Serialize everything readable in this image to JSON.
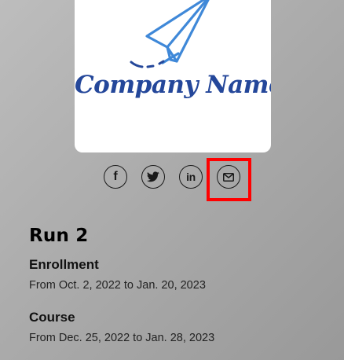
{
  "logo": {
    "company_name": "Company Name",
    "icon": "paper-plane-icon"
  },
  "share": {
    "facebook": {
      "icon": "facebook-icon",
      "glyph": "f"
    },
    "twitter": {
      "icon": "twitter-icon"
    },
    "linkedin": {
      "icon": "linkedin-icon",
      "glyph": "in"
    },
    "email": {
      "icon": "email-icon"
    }
  },
  "highlight_color": "#ff0000",
  "brand_color": "#24479a",
  "run": {
    "title": "Run 2",
    "sections": [
      {
        "heading": "Enrollment",
        "text": "From Oct. 2, 2022 to Jan. 20, 2023"
      },
      {
        "heading": "Course",
        "text": "From Dec. 25, 2022 to Jan. 28, 2023"
      }
    ]
  }
}
